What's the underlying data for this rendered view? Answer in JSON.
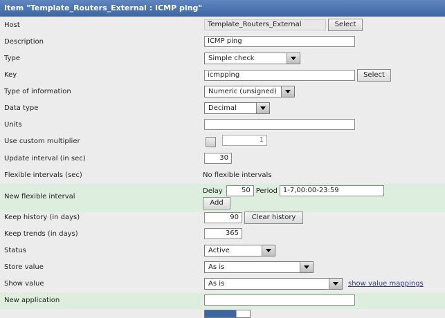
{
  "title": "Item \"Template_Routers_External : ICMP ping\"",
  "labels": {
    "host": "Host",
    "description": "Description",
    "type": "Type",
    "key": "Key",
    "type_info": "Type of information",
    "data_type": "Data type",
    "units": "Units",
    "multiplier": "Use custom multiplier",
    "update": "Update interval (in sec)",
    "flex": "Flexible intervals (sec)",
    "new_flex": "New flexible interval",
    "history": "Keep history (in days)",
    "trends": "Keep trends (in days)",
    "status": "Status",
    "store": "Store value",
    "show": "Show value",
    "new_app": "New application"
  },
  "values": {
    "host": "Template_Routers_External",
    "description": "ICMP ping",
    "type": "Simple check",
    "key": "icmpping",
    "type_info": "Numeric (unsigned)",
    "data_type": "Decimal",
    "units": "",
    "multiplier": "1",
    "update": "30",
    "flex": "No flexible intervals",
    "delay_label": "Delay",
    "delay": "50",
    "period_label": "Period",
    "period": "1-7,00:00-23:59",
    "history": "90",
    "trends": "365",
    "status": "Active",
    "store": "As is",
    "show": "As is",
    "new_app": ""
  },
  "buttons": {
    "select": "Select",
    "add": "Add",
    "clear_history": "Clear history",
    "value_mappings": "show value mappings"
  }
}
